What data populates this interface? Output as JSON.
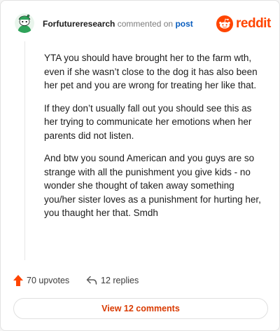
{
  "comment": {
    "author": "Forfutureresearch",
    "action_text": "commented on",
    "post_link": "post",
    "paragraphs": [
      "YTA you should have brought her to the farm wth, even if she wasn’t close to the dog it has also been her pet and you are wrong for treating her like that.",
      "If they don’t usually fall out you should see this as her trying to communicate her emotions when her parents did not listen.",
      "And btw you sound American and you guys are so strange with all the punishment you give kids - no wonder she thought of taken away something you/her sister loves as a punishment for hurting her, you thaught her that. Smdh"
    ]
  },
  "brand": {
    "logo_text": "reddit",
    "color": "#ff4500"
  },
  "actions": {
    "upvotes_label": "70 upvotes",
    "replies_label": "12 replies",
    "upvote_icon": "upvote-arrow-icon",
    "reply_icon": "reply-arrow-icon",
    "upvote_color": "#ff4500"
  },
  "footer": {
    "view_comments_label": "View 12 comments",
    "link_color": "#d93a00"
  }
}
